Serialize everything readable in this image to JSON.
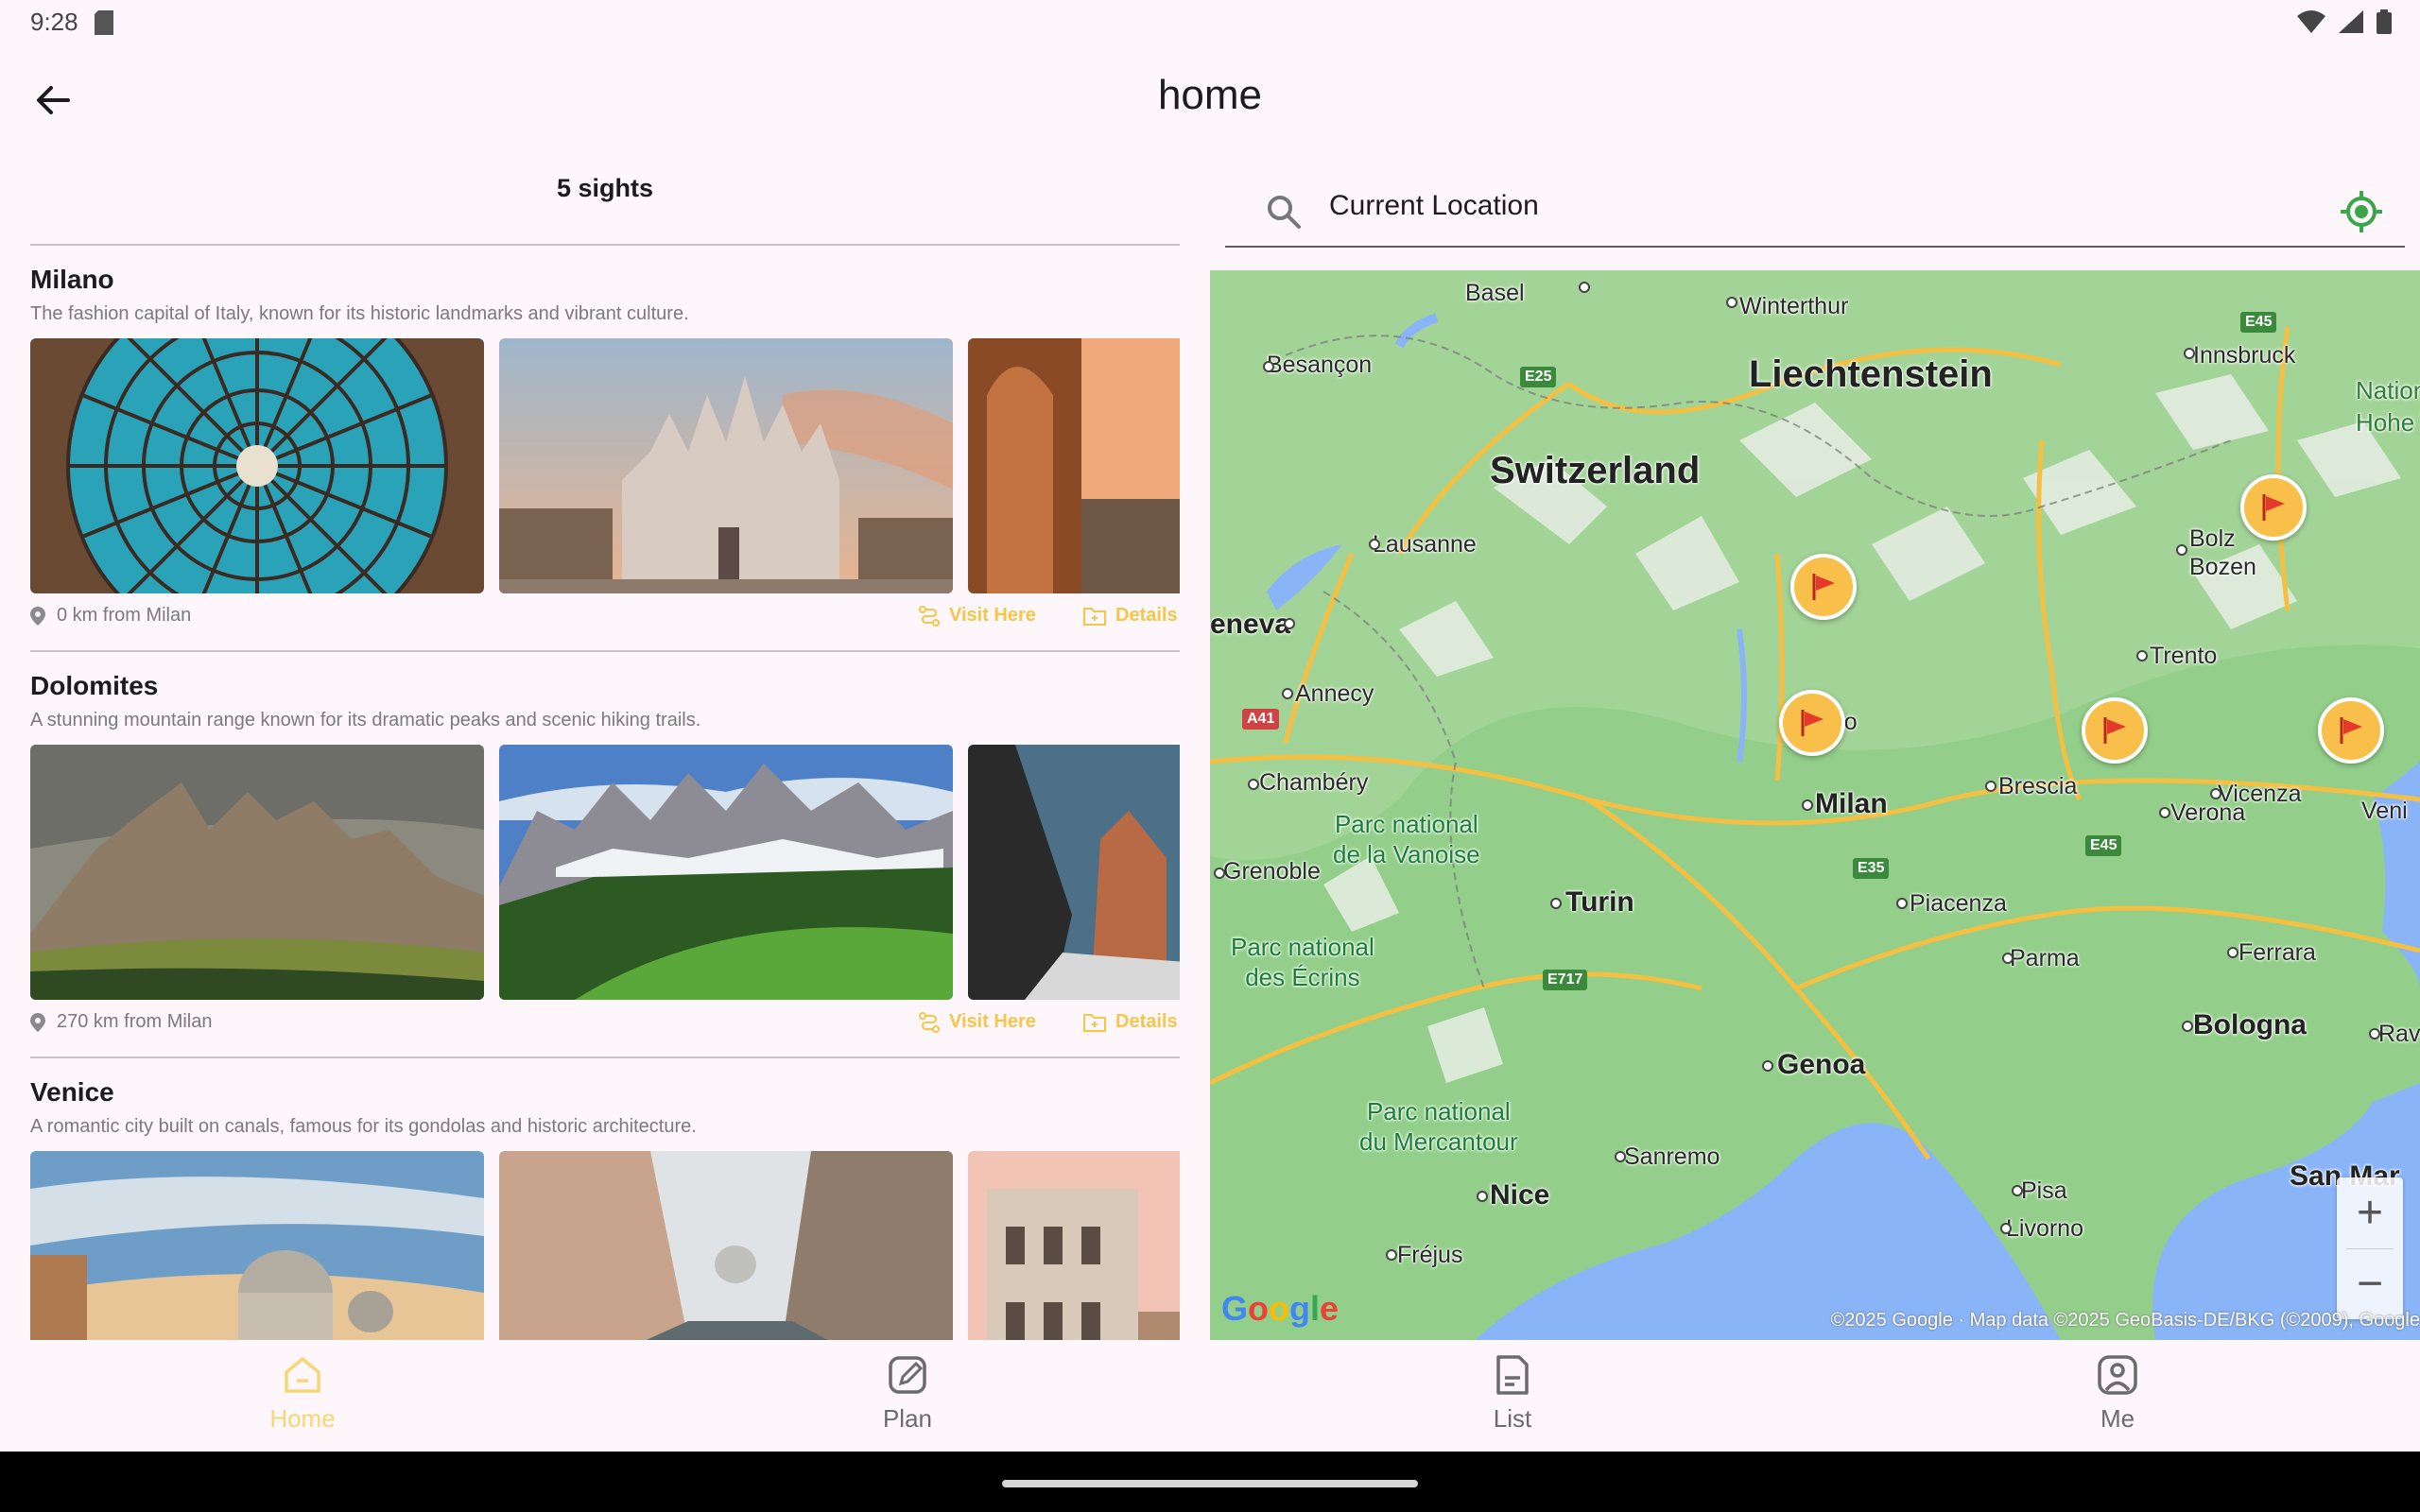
{
  "status_bar": {
    "time": "9:28"
  },
  "app_bar": {
    "title": "home"
  },
  "list": {
    "count_label": "5 sights",
    "sections": [
      {
        "title": "Milano",
        "description": "The fashion capital of Italy, known for its historic landmarks and vibrant culture.",
        "distance": "0 km from Milan",
        "visit_label": "Visit Here",
        "details_label": "Details"
      },
      {
        "title": "Dolomites",
        "description": "A stunning mountain range known for its dramatic peaks and scenic hiking trails.",
        "distance": "270 km from Milan",
        "visit_label": "Visit Here",
        "details_label": "Details"
      },
      {
        "title": "Venice",
        "description": "A romantic city built on canals, famous for its gondolas and historic architecture.",
        "distance": "",
        "visit_label": "",
        "details_label": ""
      }
    ]
  },
  "search": {
    "value": "Current Location",
    "placeholder": "Current Location"
  },
  "map": {
    "countries": [
      "Switzerland",
      "Liechtenstein"
    ],
    "cities": [
      "Basel",
      "Winterthur",
      "Innsbruck",
      "Besançon",
      "Lausanne",
      "Bolz",
      "Bozen",
      "eneva",
      "Annecy",
      "Trento",
      "Como",
      "Chambéry",
      "Milan",
      "Brescia",
      "Verona",
      "Vicenza",
      "Veni",
      "Grenoble",
      "Turin",
      "Piacenza",
      "Parma",
      "Ferrara",
      "Bologna",
      "Ravenn",
      "Genoa",
      "Sanremo",
      "Nice",
      "Pisa",
      "Livorno",
      "Fréjus",
      "San Mar",
      "Nationa",
      "Hohe T"
    ],
    "parks": [
      "Parc national\nde la Vanoise",
      "Parc national\ndes Écrins",
      "Parc national\ndu Mercantour"
    ],
    "roads": [
      "E45",
      "E25",
      "A41",
      "E35",
      "E717",
      "E45"
    ],
    "zoom_in": "+",
    "zoom_out": "−",
    "logo": "Google",
    "attribution": "©2025 Google · Map data ©2025 GeoBasis-DE/BKG (©2009), Google"
  },
  "bottom_nav": [
    {
      "label": "Home",
      "icon": "home-icon",
      "active": true
    },
    {
      "label": "Plan",
      "icon": "edit-icon",
      "active": false
    },
    {
      "label": "List",
      "icon": "list-icon",
      "active": false
    },
    {
      "label": "Me",
      "icon": "profile-icon",
      "active": false
    }
  ],
  "colors": {
    "accent": "#f7d774",
    "marker": "#f8c04a",
    "background": "#fdf6fb",
    "map_land": "#93cf8a",
    "map_water": "#8ab4f8"
  }
}
